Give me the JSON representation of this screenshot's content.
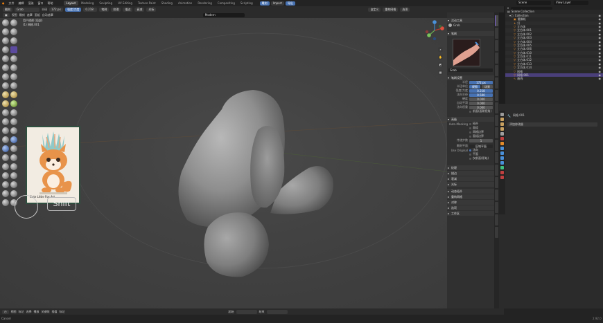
{
  "topbar": {
    "menus": [
      "文件",
      "编辑",
      "渲染",
      "窗口",
      "帮助"
    ],
    "workspaces": [
      "Layout",
      "Modeling",
      "Sculpting",
      "UV Editing",
      "Texture Paint",
      "Shading",
      "Animation",
      "Rendering",
      "Compositing",
      "Scripting"
    ],
    "active_workspace": "Layout",
    "scene_label": "Scene",
    "view_layer_label": "View Layer",
    "center_labels": [
      "雕刻",
      "Import",
      "导出"
    ]
  },
  "header": {
    "mode": "雕刻",
    "brush": "Grab",
    "radius_label": "半径",
    "radius_value": "172 px",
    "strength_label": "强度/力度",
    "strength_value": "0.218",
    "menus": [
      "笔刷",
      "纹理",
      "描边",
      "衰减",
      "光标"
    ],
    "right_items": [
      "自定义",
      "重构网格",
      "选项"
    ]
  },
  "subheader": {
    "items": [
      "视图",
      "雕刻",
      "遮罩",
      "面组",
      "自动遮罩"
    ],
    "center": "Modern"
  },
  "viewport": {
    "title_line1": "用户透视 (局部)",
    "title_line2": "(1) 网格.001",
    "reference_caption": "Cute Little Fox Art",
    "shift_key": "Shift"
  },
  "npanel": {
    "active_tool": "活动工具",
    "brushes": "笔刷",
    "brush_name": "Grab",
    "brush_settings": "笔刷设置",
    "radius_label": "半径",
    "radius_value": "172 px",
    "radius_unit_label": "半径单位",
    "radius_unit_tabs": [
      "视图",
      "场景"
    ],
    "strength_label": "强度/力度",
    "strength_value": "0.218",
    "normal_radius_label": "法向半径",
    "normal_radius_value": "0.500",
    "hardness_label": "硬度",
    "hardness_value": "0.000",
    "auto_smooth_label": "自动平滑",
    "auto_smooth_value": "0.000",
    "normal_weight_label": "法向权重",
    "normal_weight_value": "0.000",
    "front_faces": "前面(面朝视角)",
    "advanced": "高级",
    "automask_label": "Auto-Masking",
    "automask_options": [
      "拓扑",
      "面组",
      "网格边界",
      "面组边界"
    ],
    "propagation_label": "传递步数",
    "propagation_value": "1",
    "sculpt_plane_label": "雕刻平面",
    "sculpt_plane_value": "区域平面",
    "use_original_label": "Use Original",
    "use_original_options": [
      "法向",
      "平面"
    ],
    "original_normal": "仅前面(原始)",
    "collapsed_sections": [
      "纹理",
      "描边",
      "衰减",
      "光标",
      "动态拓扑",
      "重构网格",
      "对称",
      "选项",
      "工作区"
    ]
  },
  "outliner": {
    "root": "Scene Collection",
    "collection": "Collection",
    "items": [
      "摄像机",
      "灯",
      "立方体",
      "立方体.001",
      "立方体.002",
      "立方体.003",
      "立方体.004",
      "立方体.005",
      "立方体.006",
      "立方体.010",
      "立方体.011",
      "立方体.012",
      "立方体.013",
      "立方体.014",
      "网格",
      "网格.001",
      "曲线"
    ],
    "selected": "网格.001"
  },
  "properties": {
    "object_name": "网格.001",
    "header": "添加修改器"
  },
  "bottombar": {
    "items": [
      "视图",
      "标记",
      "选择",
      "播放",
      "关键帧",
      "插值",
      "标记"
    ],
    "start_label": "起始",
    "end_label": "结束"
  },
  "status": {
    "text": "Cancel",
    "version": "2.92.0"
  },
  "colors": {
    "accent": "#4772b3",
    "selection": "#7a5fd0",
    "viewport_bg": "#434343",
    "object_orange": "#e38b2a"
  }
}
